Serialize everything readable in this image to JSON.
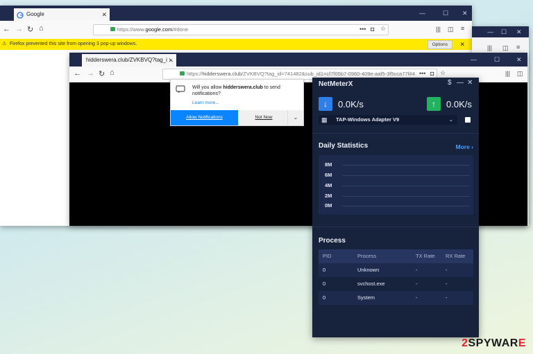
{
  "back_browser": {
    "tab_title": "Google",
    "url_prefix": "https://www.",
    "url_domain": "google.com",
    "url_suffix": "/#done",
    "notification_bar": "Firefox prevented this site from opening 3 pop-up windows.",
    "options_label": "Options",
    "window_controls": [
      "—",
      "☐",
      "✕"
    ]
  },
  "front_browser": {
    "tab_title": "hidderswera.club/ZVKBVQ?tag_i",
    "url_prefix": "https://",
    "url_domain": "hidderswera.club",
    "url_suffix": "/ZVKBVQ?tag_id=741482&sub_id1=cf7f05b7-0960-409e-aaf5-3f5cca77f#4",
    "window_controls": [
      "—",
      "☐",
      "✕"
    ]
  },
  "permission_popup": {
    "message_pre": "Will you allow ",
    "site": "hidderswera.club",
    "message_post": " to send notifications?",
    "learn_more": "Learn more...",
    "allow_label": "Allow Notifications",
    "deny_label": "Not Now"
  },
  "netmeter": {
    "title": "NetMeterX",
    "download_speed": "0.0K/s",
    "upload_speed": "0.0K/s",
    "adapter": "TAP-Windows Adapter V9",
    "daily_title": "Daily Statistics",
    "more_label": "More",
    "y_ticks": [
      "8M",
      "6M",
      "4M",
      "2M",
      "0M"
    ],
    "process_title": "Process",
    "table_headers": [
      "PID",
      "Process",
      "TX Rate",
      "RX Rate"
    ],
    "table_rows": [
      [
        "0",
        "Unknown",
        "-",
        "-"
      ],
      [
        "0",
        "svchost.exe",
        "-",
        "-"
      ],
      [
        "0",
        "System",
        "-",
        "-"
      ]
    ]
  },
  "watermark": {
    "prefix": "2",
    "brand": "SPYWAR",
    "suffix": "E"
  },
  "colors": {
    "accent_blue": "#2f7fe8",
    "accent_green": "#21b35f",
    "firefox_yellow": "#ffe900",
    "netmeter_bg": "#17223d"
  }
}
